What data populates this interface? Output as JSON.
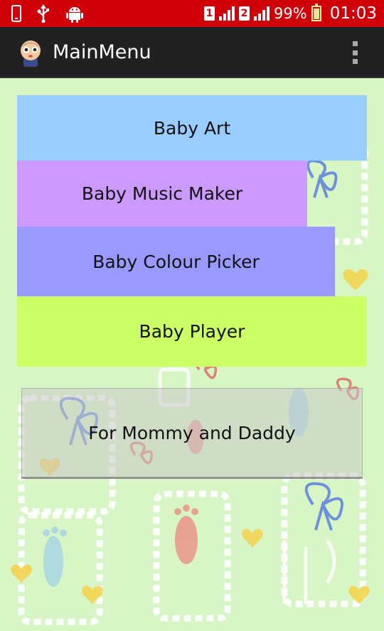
{
  "status_bar": {
    "sim1": "1",
    "sim2": "2",
    "battery_percent": "99%",
    "time": "01:03",
    "icons": [
      "phone-icon",
      "usb-icon",
      "android-icon",
      "signal-icon",
      "battery-charging-icon"
    ]
  },
  "action_bar": {
    "title": "MainMenu",
    "icon": "baby-face-icon",
    "overflow_icon": "overflow-menu-icon"
  },
  "menu": {
    "baby_art": "Baby Art",
    "baby_music_maker": "Baby Music Maker",
    "baby_colour_picker": "Baby Colour Picker",
    "baby_player": "Baby Player",
    "for_parents": "For Mommy and Daddy"
  },
  "colors": {
    "status_bar": "#d0000a",
    "action_bar": "#212121",
    "background": "#d7f5c5",
    "baby_art": "#99ccff",
    "baby_music_maker": "#cc99ff",
    "baby_colour_picker": "#9999ff",
    "baby_player": "#ccff66"
  }
}
